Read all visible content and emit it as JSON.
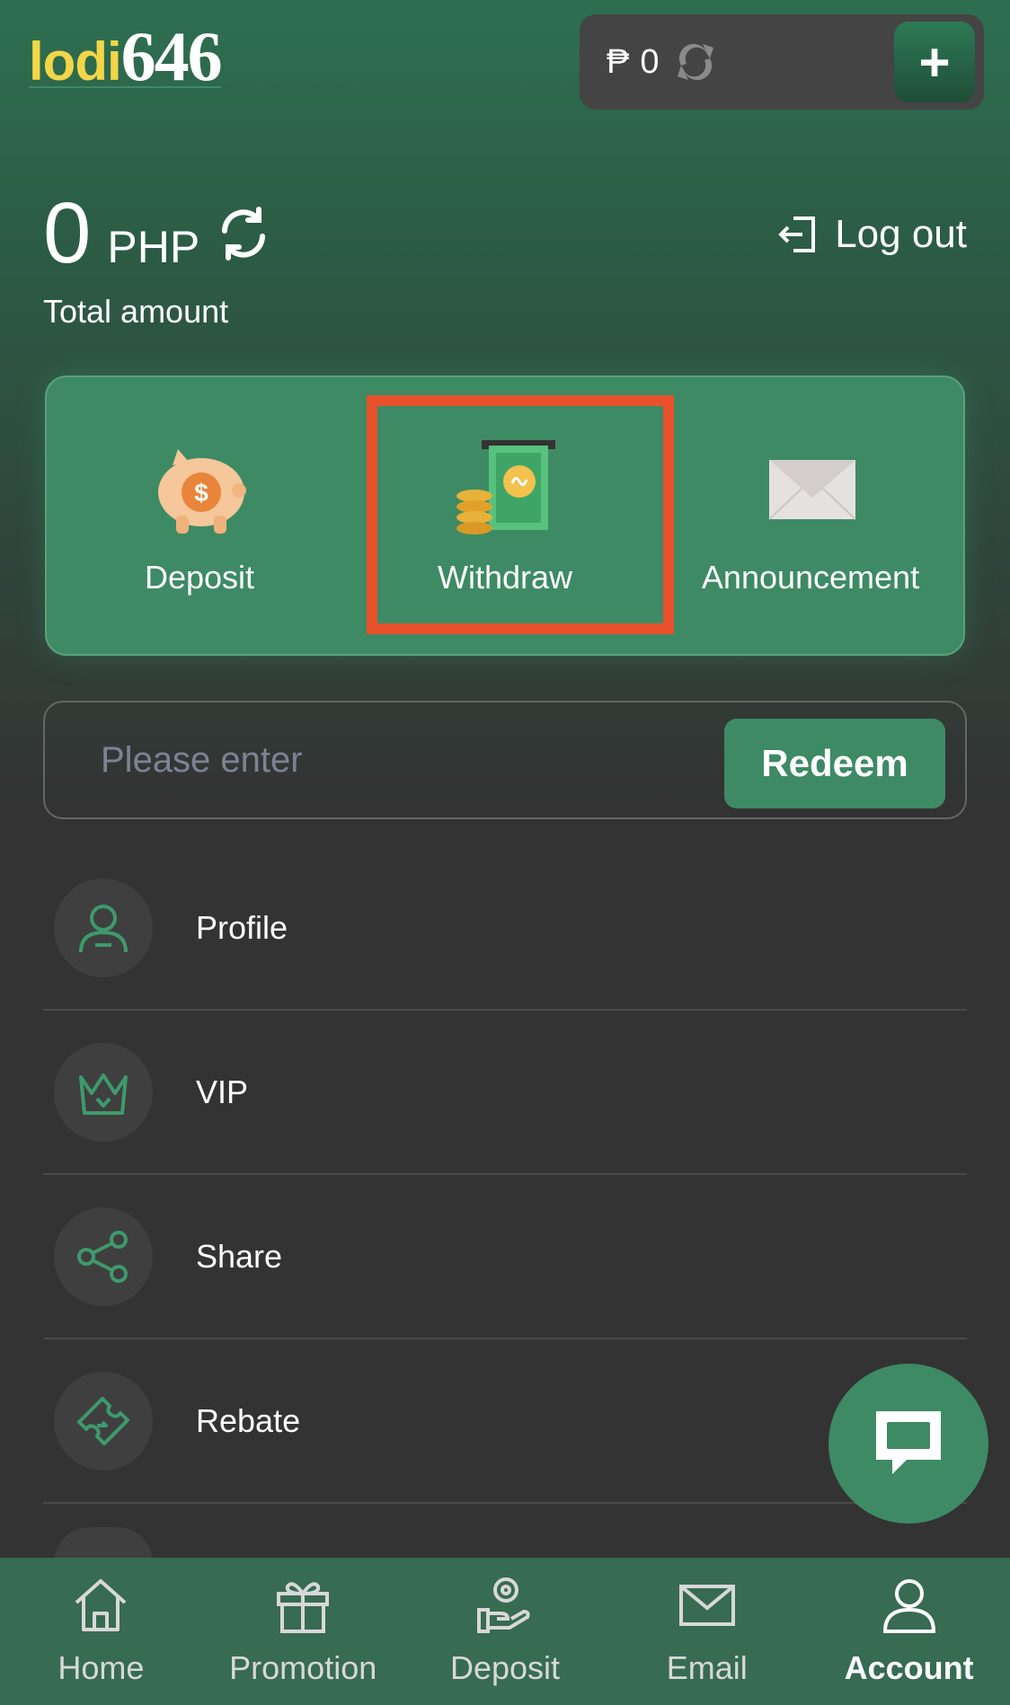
{
  "header": {
    "logo_part_a": "lodi",
    "logo_part_b": "646",
    "wallet_currency": "₱",
    "wallet_amount": "0",
    "add_funds_symbol": "+"
  },
  "balance": {
    "amount": "0",
    "currency": "PHP",
    "label": "Total amount"
  },
  "logout_label": "Log out",
  "actions": [
    {
      "label": "Deposit"
    },
    {
      "label": "Withdraw"
    },
    {
      "label": "Announcement"
    }
  ],
  "redeem": {
    "placeholder": "Please enter",
    "value": "",
    "button_label": "Redeem"
  },
  "menu": [
    {
      "label": "Profile"
    },
    {
      "label": "VIP"
    },
    {
      "label": "Share"
    },
    {
      "label": "Rebate"
    }
  ],
  "nav": [
    {
      "label": "Home",
      "icon": "home-icon"
    },
    {
      "label": "Promotion",
      "icon": "gift-icon"
    },
    {
      "label": "Deposit",
      "icon": "hand-coin-icon"
    },
    {
      "label": "Email",
      "icon": "envelope-icon"
    },
    {
      "label": "Account",
      "icon": "user-icon",
      "active": true
    }
  ],
  "colors": {
    "accent": "#3e8a64",
    "highlight": "#e8512c",
    "logo_yellow": "#f2d648",
    "background": "#333333"
  }
}
